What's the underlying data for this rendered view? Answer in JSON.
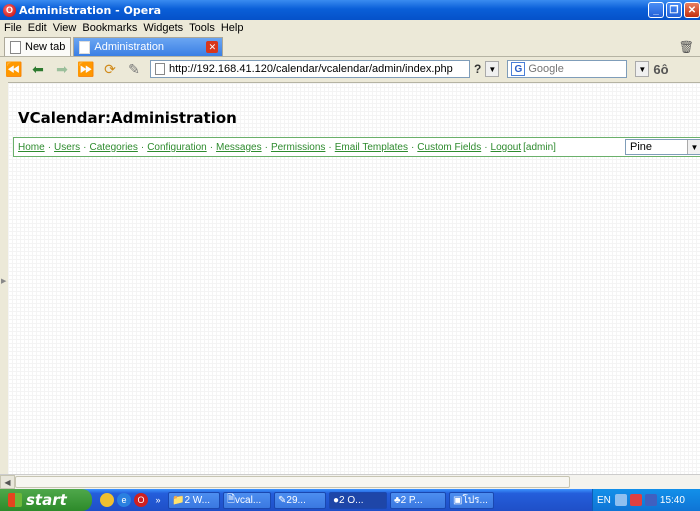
{
  "window": {
    "title": "Administration - Opera",
    "app_icon": "opera-icon"
  },
  "menu": [
    "File",
    "Edit",
    "View",
    "Bookmarks",
    "Widgets",
    "Tools",
    "Help"
  ],
  "tabs": [
    {
      "label": "New tab",
      "active": false
    },
    {
      "label": "Administration",
      "active": true
    }
  ],
  "address": {
    "url": "http://192.168.41.120/calendar/vcalendar/admin/index.php",
    "help": "?"
  },
  "search": {
    "engine_letter": "G",
    "placeholder": "Google"
  },
  "page": {
    "title": "VCalendar:Administration",
    "nav_links": [
      "Home",
      "Users",
      "Categories",
      "Configuration",
      "Messages",
      "Permissions",
      "Email Templates",
      "Custom Fields",
      "Logout"
    ],
    "user_label": "[admin]",
    "skin_selected": "Pine"
  },
  "taskbar": {
    "start_label": "start",
    "more_label": "»",
    "tasks": [
      "2 W...",
      "vcal...",
      "29...",
      "2 O...",
      "2 P...",
      "โปร..."
    ],
    "lang": "EN",
    "time": "15:40"
  },
  "colors": {
    "accent_link": "#2e8b2e",
    "title_bar": "#0a5fd8"
  }
}
